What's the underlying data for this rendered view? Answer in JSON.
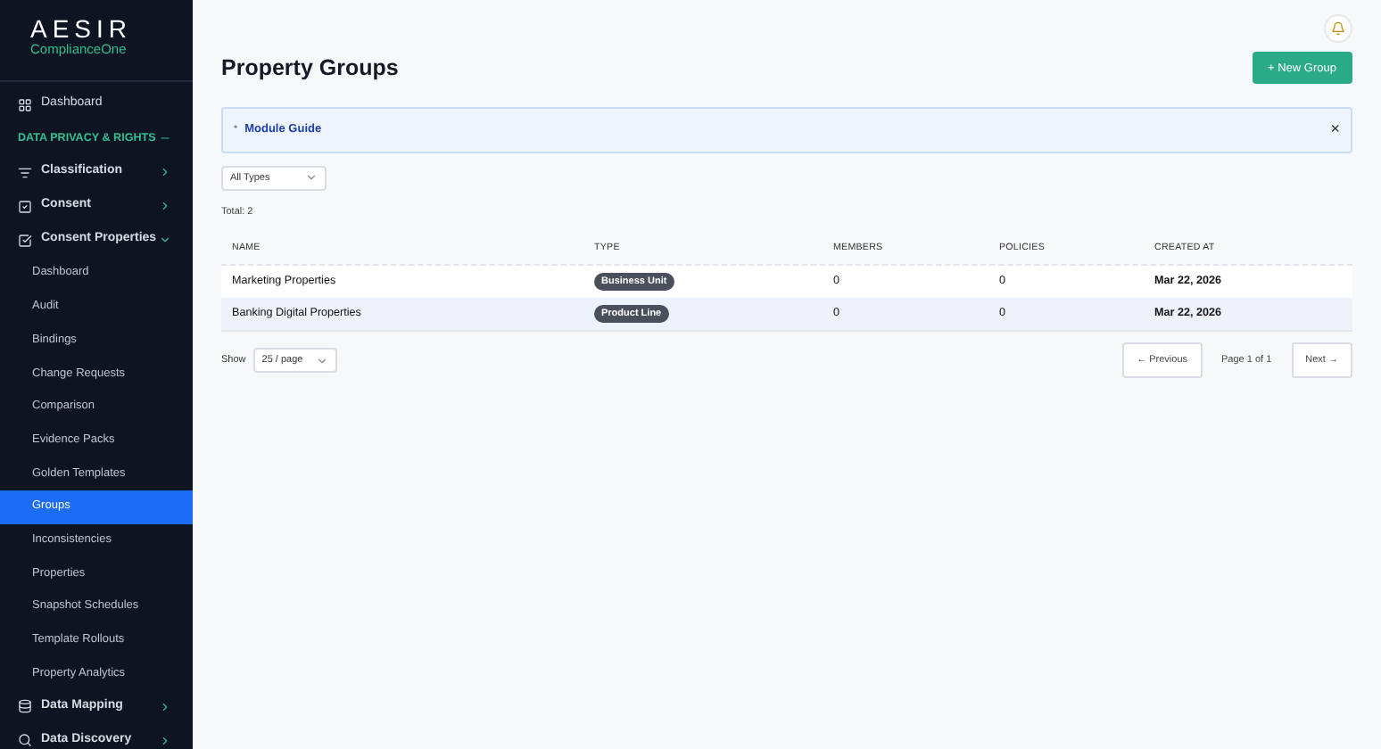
{
  "brand": {
    "name": "AESIR",
    "product": "ComplianceOne"
  },
  "sidebar": {
    "items": [
      {
        "kind": "link",
        "label": "Dashboard"
      },
      {
        "kind": "section",
        "label": "DATA PRIVACY & RIGHTS",
        "expanded": true
      },
      {
        "kind": "group",
        "label": "Classification",
        "expanded": false
      },
      {
        "kind": "group",
        "label": "Consent",
        "expanded": false
      },
      {
        "kind": "group",
        "label": "Consent Properties",
        "expanded": true,
        "children": [
          {
            "label": "Dashboard",
            "selected": false
          },
          {
            "label": "Audit",
            "selected": false
          },
          {
            "label": "Bindings",
            "selected": false
          },
          {
            "label": "Change Requests",
            "selected": false
          },
          {
            "label": "Comparison",
            "selected": false
          },
          {
            "label": "Evidence Packs",
            "selected": false
          },
          {
            "label": "Golden Templates",
            "selected": false
          },
          {
            "label": "Groups",
            "selected": true
          },
          {
            "label": "Inconsistencies",
            "selected": false
          },
          {
            "label": "Properties",
            "selected": false
          },
          {
            "label": "Snapshot Schedules",
            "selected": false
          },
          {
            "label": "Template Rollouts",
            "selected": false
          },
          {
            "label": "Property Analytics",
            "selected": false
          }
        ]
      },
      {
        "kind": "group",
        "label": "Data Mapping",
        "expanded": false
      },
      {
        "kind": "group",
        "label": "Data Discovery",
        "expanded": false
      }
    ]
  },
  "page": {
    "title": "Property Groups",
    "new_button": "+ New Group"
  },
  "guide": {
    "bullet": "•",
    "label": "Module Guide",
    "close": "×"
  },
  "filter": {
    "value": "All Types"
  },
  "total": "Total: 2",
  "table": {
    "columns": [
      "NAME",
      "TYPE",
      "MEMBERS",
      "POLICIES",
      "CREATED AT"
    ],
    "rows": [
      {
        "name": "Marketing Properties",
        "type": "Business Unit",
        "members": "0",
        "policies": "0",
        "created": "Mar 22, 2026",
        "selected": false
      },
      {
        "name": "Banking Digital Properties",
        "type": "Product Line",
        "members": "0",
        "policies": "0",
        "created": "Mar 22, 2026",
        "selected": true
      }
    ]
  },
  "pagination": {
    "show_label": "Show",
    "page_size": "25 / page",
    "previous": "← Previous",
    "page_info": "Page 1 of 1",
    "next": "Next →"
  }
}
